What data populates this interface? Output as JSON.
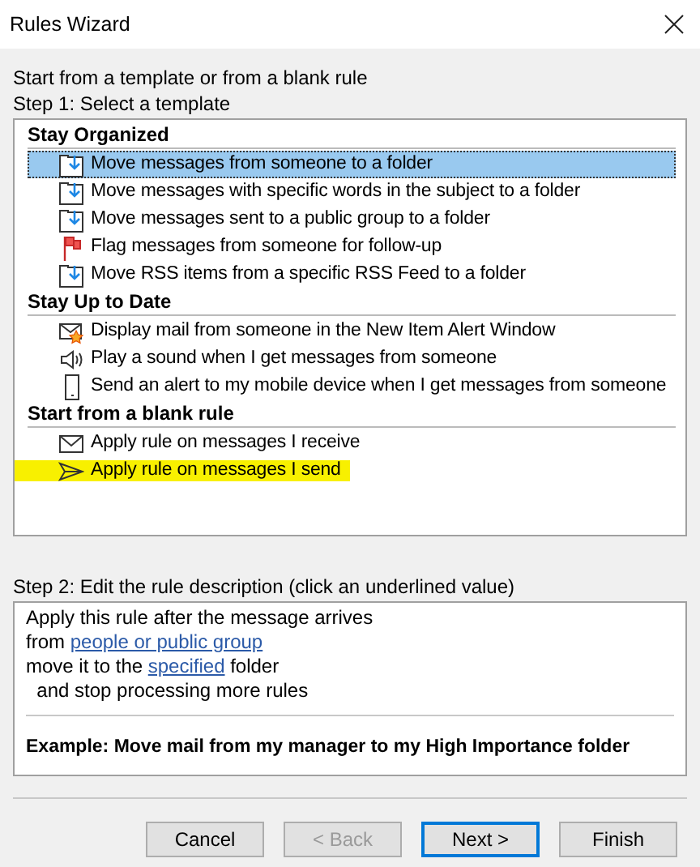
{
  "window": {
    "title": "Rules Wizard"
  },
  "intro": "Start from a template or from a blank rule",
  "step1": "Step 1: Select a template",
  "groups": [
    {
      "title": "Stay Organized",
      "items": [
        {
          "kind": "move",
          "label": "Move messages from someone to a folder",
          "selected": true,
          "highlighted": false
        },
        {
          "kind": "move",
          "label": "Move messages with specific words in the subject to a folder",
          "selected": false,
          "highlighted": false
        },
        {
          "kind": "move",
          "label": "Move messages sent to a public group to a folder",
          "selected": false,
          "highlighted": false
        },
        {
          "kind": "flag",
          "label": "Flag messages from someone for follow-up",
          "selected": false,
          "highlighted": false
        },
        {
          "kind": "move",
          "label": "Move RSS items from a specific RSS Feed to a folder",
          "selected": false,
          "highlighted": false
        }
      ]
    },
    {
      "title": "Stay Up to Date",
      "items": [
        {
          "kind": "alert",
          "label": "Display mail from someone in the New Item Alert Window",
          "selected": false,
          "highlighted": false
        },
        {
          "kind": "sound",
          "label": "Play a sound when I get messages from someone",
          "selected": false,
          "highlighted": false
        },
        {
          "kind": "mobile",
          "label": "Send an alert to my mobile device when I get messages from someone",
          "selected": false,
          "highlighted": false
        }
      ]
    },
    {
      "title": "Start from a blank rule",
      "items": [
        {
          "kind": "receive",
          "label": "Apply rule on messages I receive",
          "selected": false,
          "highlighted": false
        },
        {
          "kind": "send",
          "label": "Apply rule on messages I send",
          "selected": false,
          "highlighted": true
        }
      ]
    }
  ],
  "step2": "Step 2: Edit the rule description (click an underlined value)",
  "description": [
    [
      {
        "kind": "text",
        "text": "Apply this rule after the message arrives"
      }
    ],
    [
      {
        "kind": "text",
        "text": "from "
      },
      {
        "kind": "link",
        "text": "people or public group"
      }
    ],
    [
      {
        "kind": "text",
        "text": "move it to the "
      },
      {
        "kind": "link",
        "text": "specified"
      },
      {
        "kind": "text",
        "text": " folder"
      }
    ],
    [
      {
        "kind": "text",
        "text": "  and stop processing more rules"
      }
    ]
  ],
  "example": "Example: Move mail from my manager to my High Importance folder",
  "buttons": [
    {
      "label": "Cancel",
      "disabled": false,
      "default": false
    },
    {
      "label": "< Back",
      "disabled": true,
      "default": false
    },
    {
      "label": "Next >",
      "disabled": false,
      "default": true
    },
    {
      "label": "Finish",
      "disabled": false,
      "default": false
    }
  ]
}
